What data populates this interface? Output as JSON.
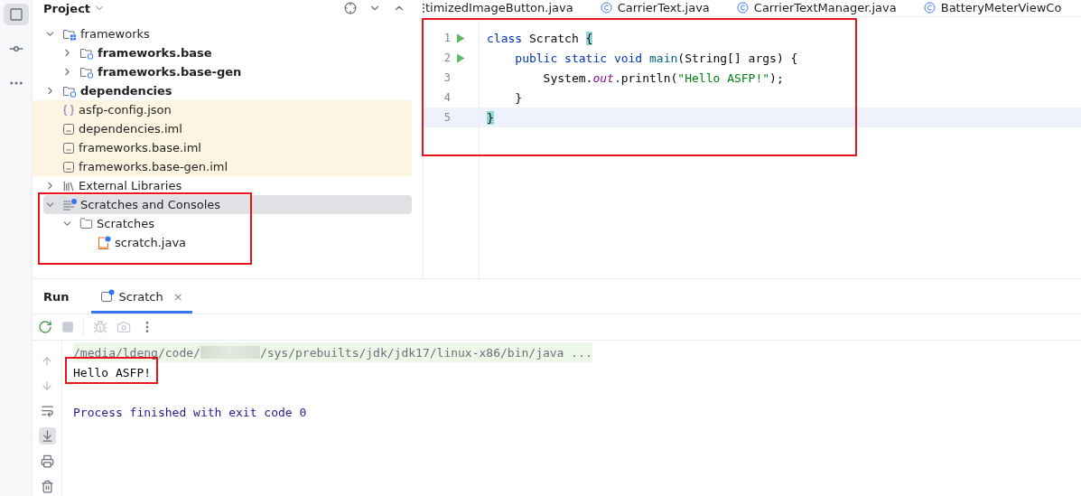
{
  "project_panel": {
    "title": "Project",
    "tree": [
      {
        "label": "frameworks",
        "kind": "module-folder",
        "bold": false,
        "expanded": true,
        "excluded": false,
        "selected": false,
        "children": [
          {
            "label": "frameworks.base",
            "kind": "module",
            "bold": true,
            "expanded": false,
            "excluded": false,
            "selected": false
          },
          {
            "label": "frameworks.base-gen",
            "kind": "module",
            "bold": true,
            "expanded": false,
            "excluded": false,
            "selected": false
          }
        ]
      },
      {
        "label": "dependencies",
        "kind": "module",
        "bold": true,
        "expanded": false,
        "excluded": false,
        "selected": false
      },
      {
        "label": "asfp-config.json",
        "kind": "json",
        "bold": false,
        "excluded": true,
        "selected": false
      },
      {
        "label": "dependencies.iml",
        "kind": "iml",
        "bold": false,
        "excluded": true,
        "selected": false
      },
      {
        "label": "frameworks.base.iml",
        "kind": "iml",
        "bold": false,
        "excluded": true,
        "selected": false
      },
      {
        "label": "frameworks.base-gen.iml",
        "kind": "iml",
        "bold": false,
        "excluded": true,
        "selected": false
      },
      {
        "label": "External Libraries",
        "kind": "libraries",
        "bold": false,
        "expanded": false,
        "excluded": false,
        "selected": false
      },
      {
        "label": "Scratches and Consoles",
        "kind": "scratches",
        "bold": false,
        "expanded": true,
        "excluded": false,
        "selected": true,
        "highlighted": true,
        "children": [
          {
            "label": "Scratches",
            "kind": "folder",
            "bold": false,
            "expanded": true,
            "excluded": false,
            "selected": false,
            "children": [
              {
                "label": "scratch.java",
                "kind": "scratch-file",
                "bold": false,
                "excluded": false,
                "selected": false
              }
            ]
          }
        ]
      }
    ]
  },
  "editor": {
    "highlighted": true,
    "tabs": [
      {
        "label": "timizedImageButton.java",
        "icon": false
      },
      {
        "label": "CarrierText.java",
        "icon": true
      },
      {
        "label": "CarrierTextManager.java",
        "icon": true
      },
      {
        "label": "BatteryMeterViewCo",
        "icon": true
      }
    ],
    "lines": [
      {
        "number": "1",
        "runnable": true,
        "current": false,
        "tokens": [
          {
            "kind": "keyword",
            "text": "class "
          },
          {
            "kind": "plain",
            "text": "Scratch "
          },
          {
            "kind": "brace",
            "text": "{"
          }
        ]
      },
      {
        "number": "2",
        "runnable": true,
        "current": false,
        "tokens": [
          {
            "kind": "keyword",
            "text": "    public static void "
          },
          {
            "kind": "method",
            "text": "main"
          },
          {
            "kind": "plain",
            "text": "(String[] args) {"
          }
        ]
      },
      {
        "number": "3",
        "current": false,
        "tokens": [
          {
            "kind": "plain",
            "text": "        System."
          },
          {
            "kind": "field",
            "text": "out"
          },
          {
            "kind": "plain",
            "text": ".println("
          },
          {
            "kind": "string",
            "text": "\"Hello ASFP!\""
          },
          {
            "kind": "plain",
            "text": ");"
          }
        ]
      },
      {
        "number": "4",
        "current": false,
        "tokens": [
          {
            "kind": "plain",
            "text": "    }"
          }
        ]
      },
      {
        "number": "5",
        "current": true,
        "tokens": [
          {
            "kind": "brace",
            "text": "}"
          }
        ]
      }
    ]
  },
  "run_panel": {
    "title": "Run",
    "tabs": [
      {
        "label": "Scratch",
        "selected": true,
        "close": "×"
      }
    ],
    "console": [
      {
        "kind": "command",
        "text": "/media/ldeng/code/",
        "text_after": "/sys/prebuilts/jdk/jdk17/linux-x86/bin/java ..."
      },
      {
        "kind": "output",
        "text": "Hello ASFP!",
        "highlighted": true
      },
      {
        "kind": "blank"
      },
      {
        "kind": "system",
        "text": "Process finished with exit code 0"
      }
    ]
  }
}
